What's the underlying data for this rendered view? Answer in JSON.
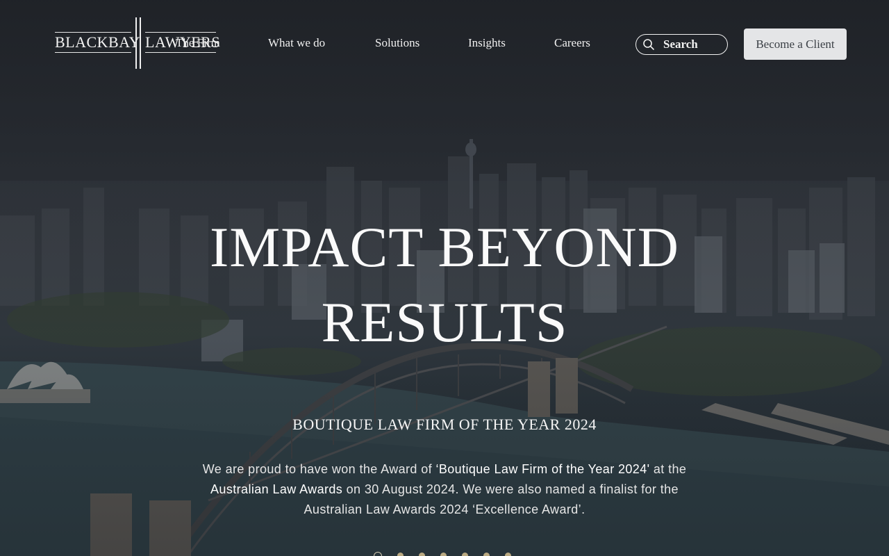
{
  "brand": {
    "logo_left": "BLACKBAY",
    "logo_right": "LAWYERS",
    "accent_color": "#cbb68a"
  },
  "nav": {
    "items": [
      {
        "label": "The Firm"
      },
      {
        "label": "What we do"
      },
      {
        "label": "Solutions"
      },
      {
        "label": "Insights"
      },
      {
        "label": "Careers"
      }
    ]
  },
  "search": {
    "icon": "search-icon",
    "placeholder": "Search"
  },
  "cta": {
    "label": "Become a Client"
  },
  "hero": {
    "headline_line1": "IMPACT BEYOND",
    "headline_line2": "RESULTS",
    "award_title": "BOUTIQUE LAW FIRM OF THE YEAR 2024",
    "body_part1": "We are proud to have won the Award of ",
    "body_highlight1": "‘Boutique Law Firm of the Year 2024'",
    "body_part2": " at the ",
    "body_highlight2": "Australian Law Awards",
    "body_part3": " on 30 August 2024. We were also named a finalist for the Australian Law Awards 2024 ‘Excellence Award’."
  },
  "carousel": {
    "slide_count": 7,
    "active_index": 0
  }
}
